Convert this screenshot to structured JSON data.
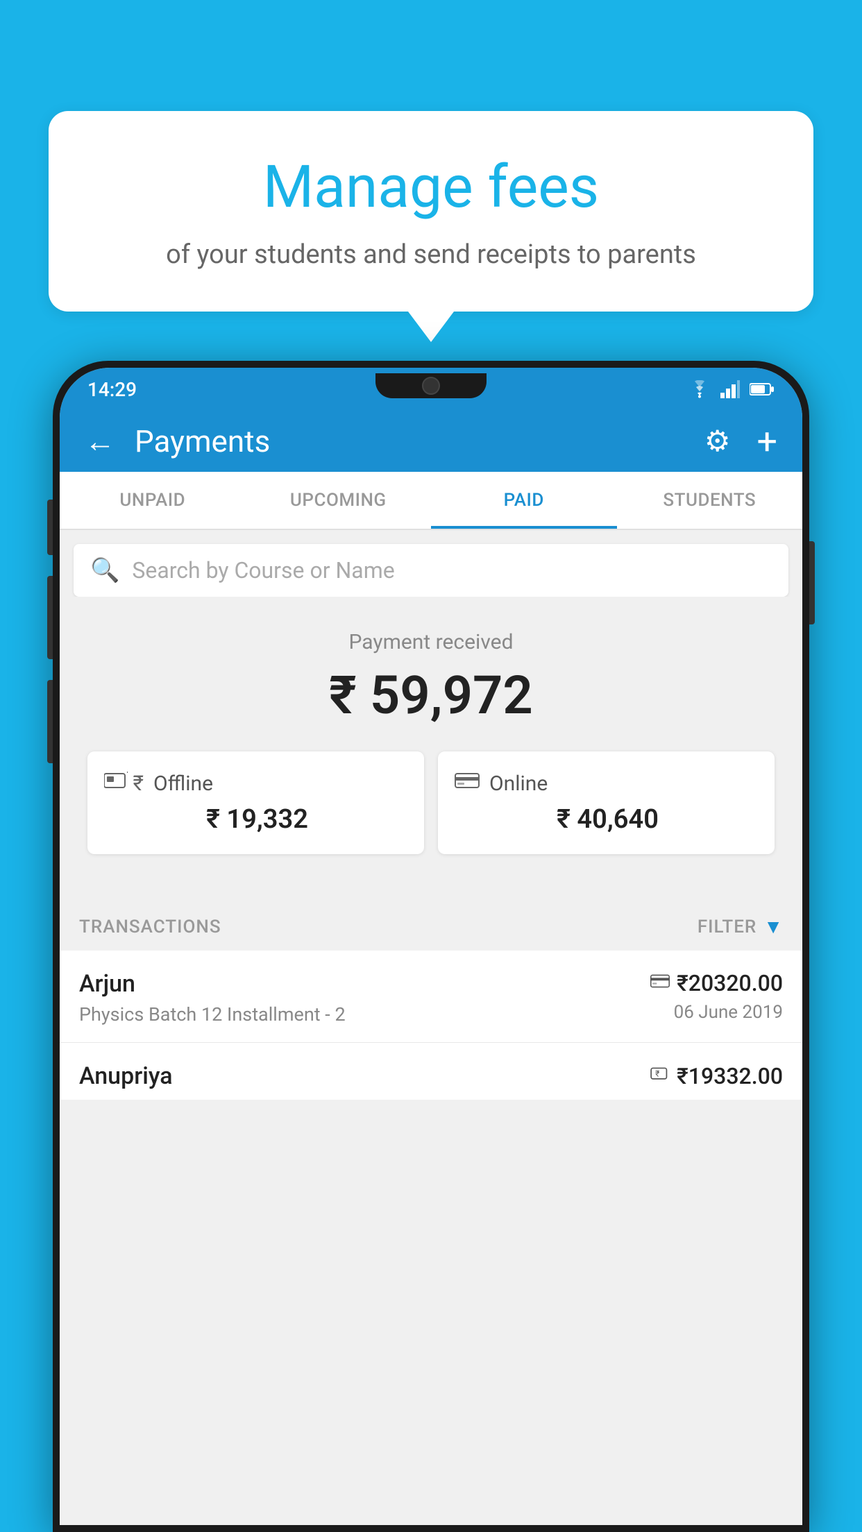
{
  "background_color": "#1ab3e8",
  "bubble": {
    "title": "Manage fees",
    "subtitle": "of your students and send receipts to parents"
  },
  "status_bar": {
    "time": "14:29",
    "wifi": "▲",
    "signal": "▲",
    "battery": "▪"
  },
  "header": {
    "title": "Payments",
    "back_label": "←",
    "gear_label": "⚙",
    "plus_label": "+"
  },
  "tabs": [
    {
      "label": "UNPAID",
      "active": false
    },
    {
      "label": "UPCOMING",
      "active": false
    },
    {
      "label": "PAID",
      "active": true
    },
    {
      "label": "STUDENTS",
      "active": false
    }
  ],
  "search": {
    "placeholder": "Search by Course or Name"
  },
  "payment_summary": {
    "label": "Payment received",
    "amount": "₹ 59,972",
    "offline_label": "Offline",
    "offline_amount": "₹ 19,332",
    "online_label": "Online",
    "online_amount": "₹ 40,640"
  },
  "transactions": {
    "label": "TRANSACTIONS",
    "filter_label": "FILTER",
    "rows": [
      {
        "name": "Arjun",
        "description": "Physics Batch 12 Installment - 2",
        "amount": "₹20320.00",
        "date": "06 June 2019",
        "payment_type": "card"
      }
    ],
    "partial_rows": [
      {
        "name": "Anupriya",
        "amount": "₹19332.00",
        "payment_type": "offline"
      }
    ]
  },
  "icons": {
    "search": "🔍",
    "gear": "⚙",
    "back_arrow": "←",
    "plus": "+",
    "filter": "▼",
    "offline_payment": "⊡",
    "online_payment": "▭",
    "card_payment": "▭",
    "rupee_offline": "₹"
  }
}
